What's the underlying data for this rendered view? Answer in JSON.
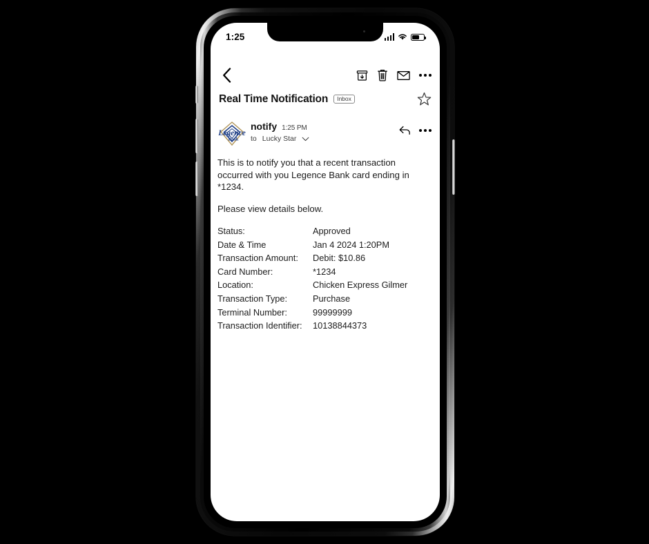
{
  "device": {
    "type": "smartphone-mockup",
    "frame_color": "#0a0a0a",
    "screen_background": "#ffffff"
  },
  "status_bar": {
    "time": "1:25",
    "icons": [
      "cellular-signal-icon",
      "wifi-icon",
      "battery-icon"
    ],
    "battery_level_pct": 62
  },
  "toolbar": {
    "back_label": "‹",
    "actions": [
      {
        "name": "archive-icon",
        "label": "Archive"
      },
      {
        "name": "trash-icon",
        "label": "Delete"
      },
      {
        "name": "mail-icon",
        "label": "Mark as unread"
      },
      {
        "name": "more-options-icon",
        "label": "More options"
      }
    ]
  },
  "email": {
    "subject": "Real Time Notification",
    "folder_badge": "Inbox",
    "starred": false,
    "star_icon": "star-outline-icon",
    "sender": {
      "name": "notify",
      "time": "1:25 PM",
      "to_prefix": "to",
      "recipient": "Lucky Star",
      "expand_icon": "chevron-down-icon",
      "avatar_name": "legence-bank-logo",
      "avatar_text_top": "Legence",
      "avatar_text_bottom": "Bank",
      "avatar_color_primary": "#1f3f86",
      "avatar_color_accent": "#b09458"
    },
    "sender_actions": [
      {
        "name": "reply-icon",
        "label": "Reply"
      },
      {
        "name": "more-options-icon",
        "label": "More options"
      }
    ],
    "body_paragraphs": [
      "This is to notify you that a recent transaction occurred with you Legence Bank card ending in *1234.",
      "Please view details below."
    ],
    "details": [
      {
        "label": "Status:",
        "value": "Approved"
      },
      {
        "label": "Date & Time",
        "value": "Jan 4 2024 1:20PM"
      },
      {
        "label": "Transaction Amount:",
        "value": "Debit: $10.86"
      },
      {
        "label": "Card Number:",
        "value": "*1234"
      },
      {
        "label": "Location:",
        "value": "Chicken Express Gilmer"
      },
      {
        "label": "Transaction Type:",
        "value": "Purchase"
      },
      {
        "label": "Terminal Number:",
        "value": "99999999"
      },
      {
        "label": "Transaction Identifier:",
        "value": "10138844373"
      }
    ]
  }
}
